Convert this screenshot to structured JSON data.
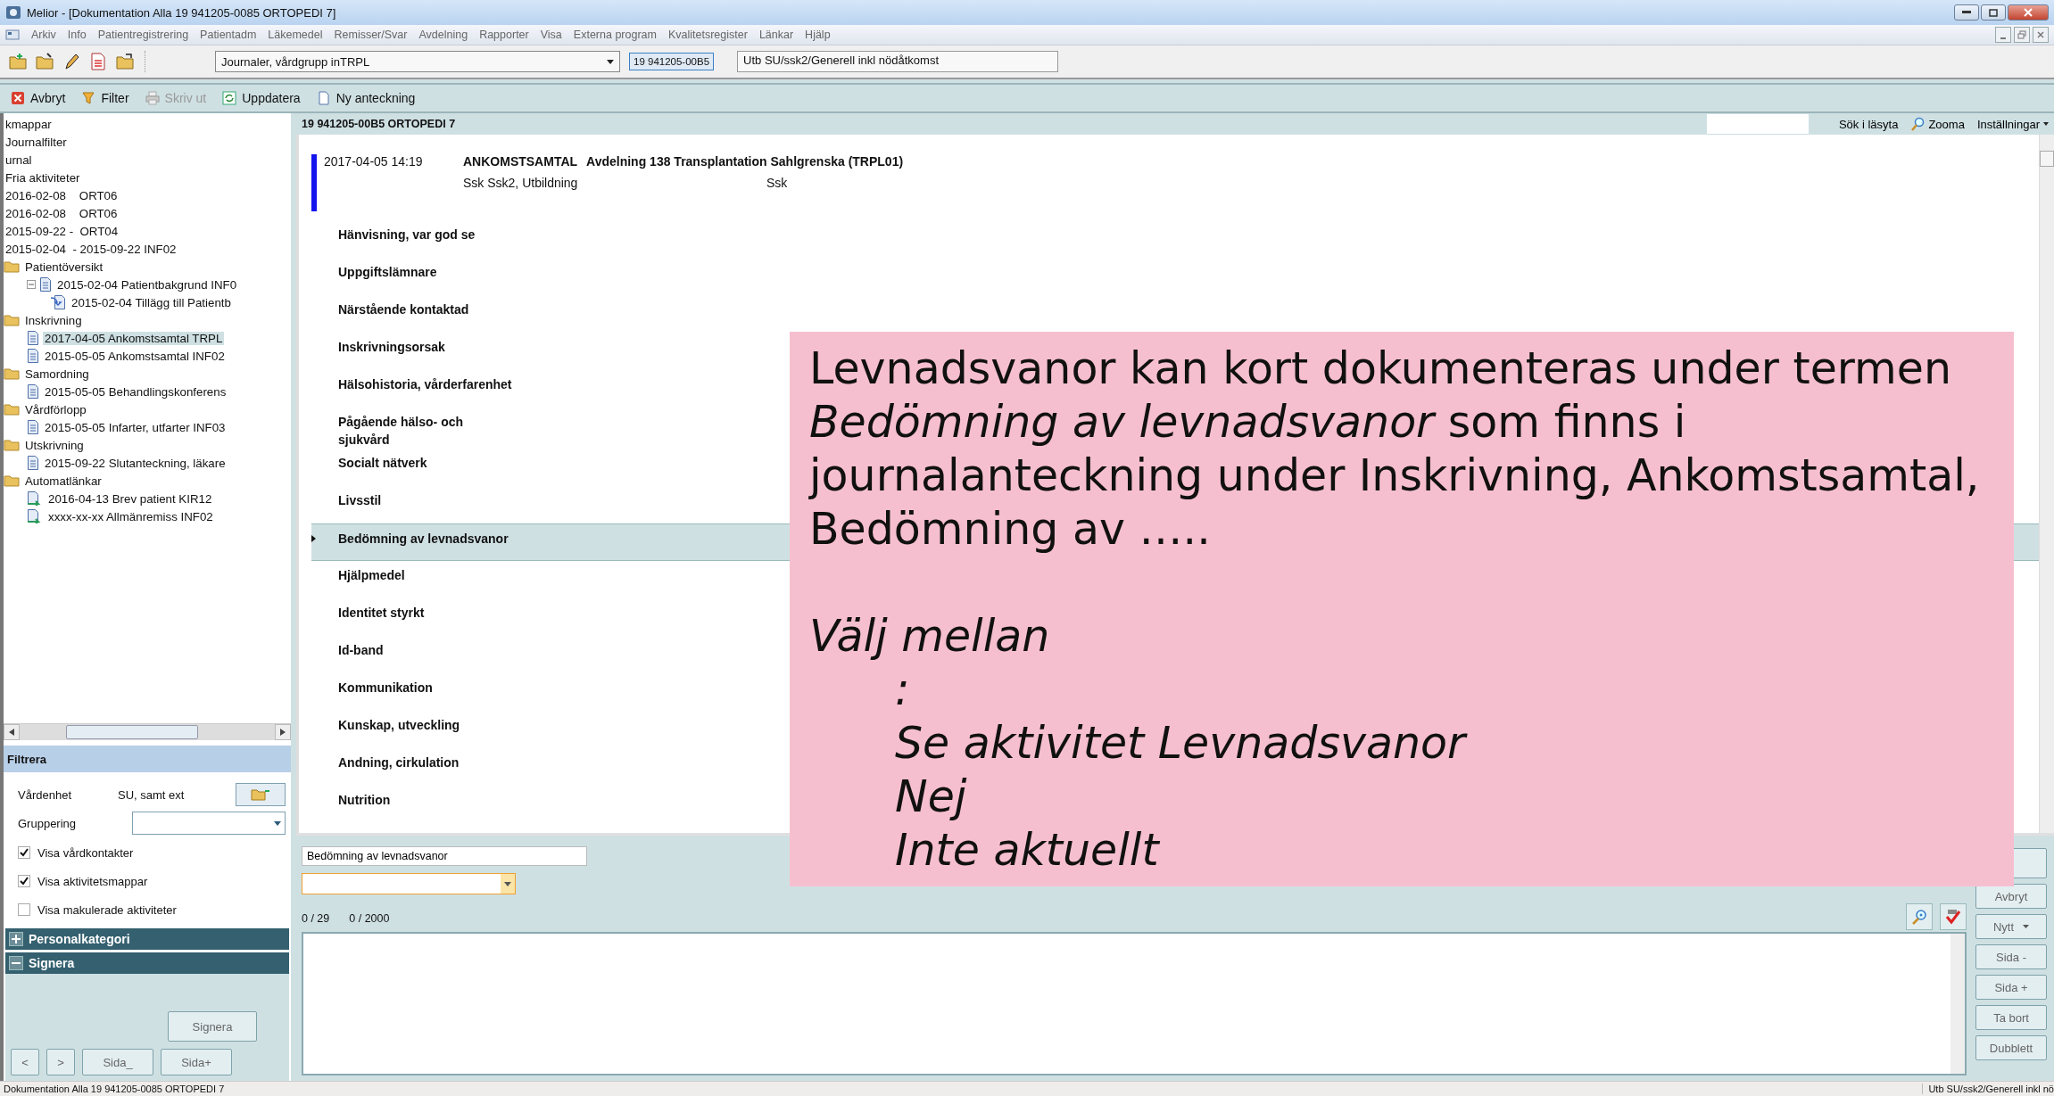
{
  "window": {
    "title": "Melior - [Dokumentation Alla 19 941205-0085 ORTOPEDI 7]"
  },
  "menu": [
    "Arkiv",
    "Info",
    "Patientregistrering",
    "Patientadm",
    "Läkemedel",
    "Remisser/Svar",
    "Avdelning",
    "Rapporter",
    "Visa",
    "Externa program",
    "Kvalitetsregister",
    "Länkar",
    "Hjälp"
  ],
  "toolbar": {
    "journal_select": "Journaler, vårdgrupp inTRPL",
    "patient_id": "19 941205-00B5",
    "context": "Utb SU/ssk2/Generell inkl nödåtkomst"
  },
  "actions": [
    {
      "label": "Avbryt",
      "kind": "cancel",
      "disabled": false
    },
    {
      "label": "Filter",
      "kind": "filter",
      "disabled": false
    },
    {
      "label": "Skriv ut",
      "kind": "print",
      "disabled": true
    },
    {
      "label": "Uppdatera",
      "kind": "refresh",
      "disabled": false
    },
    {
      "label": "Ny anteckning",
      "kind": "new",
      "disabled": false
    }
  ],
  "tree": [
    {
      "label": "kmappar",
      "kind": "text",
      "selected": false
    },
    {
      "label": "Journalfilter",
      "kind": "text",
      "selected": false
    },
    {
      "label": "urnal",
      "kind": "text",
      "selected": false
    },
    {
      "label": "Fria aktiviteter",
      "kind": "text",
      "selected": false
    },
    {
      "label": "2016-02-08    ORT06",
      "kind": "text",
      "selected": false
    },
    {
      "label": "2016-02-08    ORT06",
      "kind": "text",
      "selected": false
    },
    {
      "label": "2015-09-22 -  ORT04",
      "kind": "text",
      "selected": false
    },
    {
      "label": "2015-02-04  - 2015-09-22 INF02",
      "kind": "text",
      "selected": false
    },
    {
      "label": "Patientöversikt",
      "kind": "folder",
      "selected": false,
      "children": [
        {
          "label": "2015-02-04 Patientbakgrund INF0",
          "kind": "doc",
          "selected": false,
          "expanded": true,
          "children": [
            {
              "label": "2015-02-04 Tillägg till Patientb",
              "kind": "addendum",
              "selected": false
            }
          ]
        }
      ]
    },
    {
      "label": "Inskrivning",
      "kind": "folder",
      "selected": false,
      "children": [
        {
          "label": "2017-04-05 Ankomstsamtal TRPL",
          "kind": "doc",
          "selected": true
        },
        {
          "label": "2015-05-05 Ankomstsamtal INF02",
          "kind": "doc",
          "selected": false
        }
      ]
    },
    {
      "label": "Samordning",
      "kind": "folder",
      "selected": false,
      "children": [
        {
          "label": "2015-05-05 Behandlingskonferens",
          "kind": "doc",
          "selected": false
        }
      ]
    },
    {
      "label": "Vårdförlopp",
      "kind": "folder",
      "selected": false,
      "children": [
        {
          "label": "2015-05-05 Infarter, utfarter INF03",
          "kind": "doc",
          "selected": false
        }
      ]
    },
    {
      "label": "Utskrivning",
      "kind": "folder",
      "selected": false,
      "children": [
        {
          "label": "2015-09-22 Slutanteckning, läkare",
          "kind": "doc",
          "selected": false
        }
      ]
    },
    {
      "label": "Automatlänkar",
      "kind": "folder",
      "selected": false,
      "children": [
        {
          "label": "2016-04-13 Brev patient KIR12",
          "kind": "link",
          "selected": false
        },
        {
          "label": "xxxx-xx-xx Allmänremiss INF02",
          "kind": "link",
          "selected": false
        }
      ]
    }
  ],
  "filter": {
    "title": "Filtrera",
    "fields": [
      {
        "label": "Vårdenhet",
        "kind": "picker",
        "value": "SU, samt ext"
      },
      {
        "label": "Gruppering",
        "kind": "dropdown"
      }
    ]
  },
  "checkboxes": [
    {
      "label": "Visa vårdkontakter",
      "checked": true
    },
    {
      "label": "Visa aktivitetsmappar",
      "checked": true
    },
    {
      "label": "Visa makulerade aktiviteter",
      "checked": false
    }
  ],
  "panels": [
    {
      "label": "Personalkategori",
      "expanded": false
    },
    {
      "label": "Signera",
      "expanded": true
    }
  ],
  "sign_button": "Signera",
  "nav_buttons": [
    "<",
    ">",
    "Sida_",
    "Sida+"
  ],
  "journal": {
    "patient": "19 941205-00B5 ORTOPEDI 7",
    "search_label": "Sök i läsyta",
    "zoom": "Zooma",
    "settings": "Inställningar",
    "entry": {
      "datetime": "2017-04-05 14:19",
      "title": "ANKOMSTSAMTAL",
      "unit": "Avdelning 138 Transplantation Sahlgrenska (TRPL01)",
      "author": "Ssk Ssk2, Utbildning",
      "role": "Ssk"
    },
    "keywords": [
      {
        "label": "Hänvisning, var god se",
        "selected": false
      },
      {
        "label": "Uppgiftslämnare",
        "selected": false
      },
      {
        "label": "Närstående kontaktad",
        "selected": false
      },
      {
        "label": "Inskrivningsorsak",
        "selected": false
      },
      {
        "label": "Hälsohistoria, vårderfarenhet",
        "selected": false
      },
      {
        "label": "Pågående hälso- och\nsjukvård",
        "selected": false
      },
      {
        "label": "Socialt nätverk",
        "selected": false
      },
      {
        "label": "Livsstil",
        "selected": false
      },
      {
        "label": "Bedömning av levnadsvanor",
        "selected": true
      },
      {
        "label": "Hjälpmedel",
        "selected": false
      },
      {
        "label": "Identitet styrkt",
        "selected": false
      },
      {
        "label": "Id-band",
        "selected": false
      },
      {
        "label": "Kommunikation",
        "selected": false
      },
      {
        "label": "Kunskap, utveckling",
        "selected": false
      },
      {
        "label": "Andning, cirkulation",
        "selected": false
      },
      {
        "label": "Nutrition",
        "selected": false
      }
    ]
  },
  "editor": {
    "field_value": "Bedömning av levnadsvanor",
    "counters": [
      "0 / 29",
      "0 / 2000"
    ],
    "buttons": [
      {
        "kind": "blank"
      },
      {
        "kind": "button",
        "label": "Avbryt"
      },
      {
        "kind": "menu",
        "label": "Nytt"
      },
      {
        "kind": "button",
        "label": "Sida -"
      },
      {
        "kind": "button",
        "label": "Sida +"
      },
      {
        "kind": "button",
        "label": "Ta bort"
      },
      {
        "kind": "button",
        "label": "Dubblett"
      }
    ]
  },
  "status_bar": {
    "left": "Dokumentation Alla 19 941205-0085 ORTOPEDI 7",
    "right": "Utb SU/ssk2/Generell inkl nö"
  },
  "note": {
    "paragraph": "Levnadsvanor kan kort dokumenteras under termen *Bedömning av levnadsvanor* som finns i journalanteckning under Inskrivning, Ankomstsamtal, Bedömning av …..",
    "heading": "Välj mellan",
    "options": [
      ":",
      "Se aktivitet Levnadsvanor",
      "Nej",
      "Inte aktuellt"
    ]
  }
}
